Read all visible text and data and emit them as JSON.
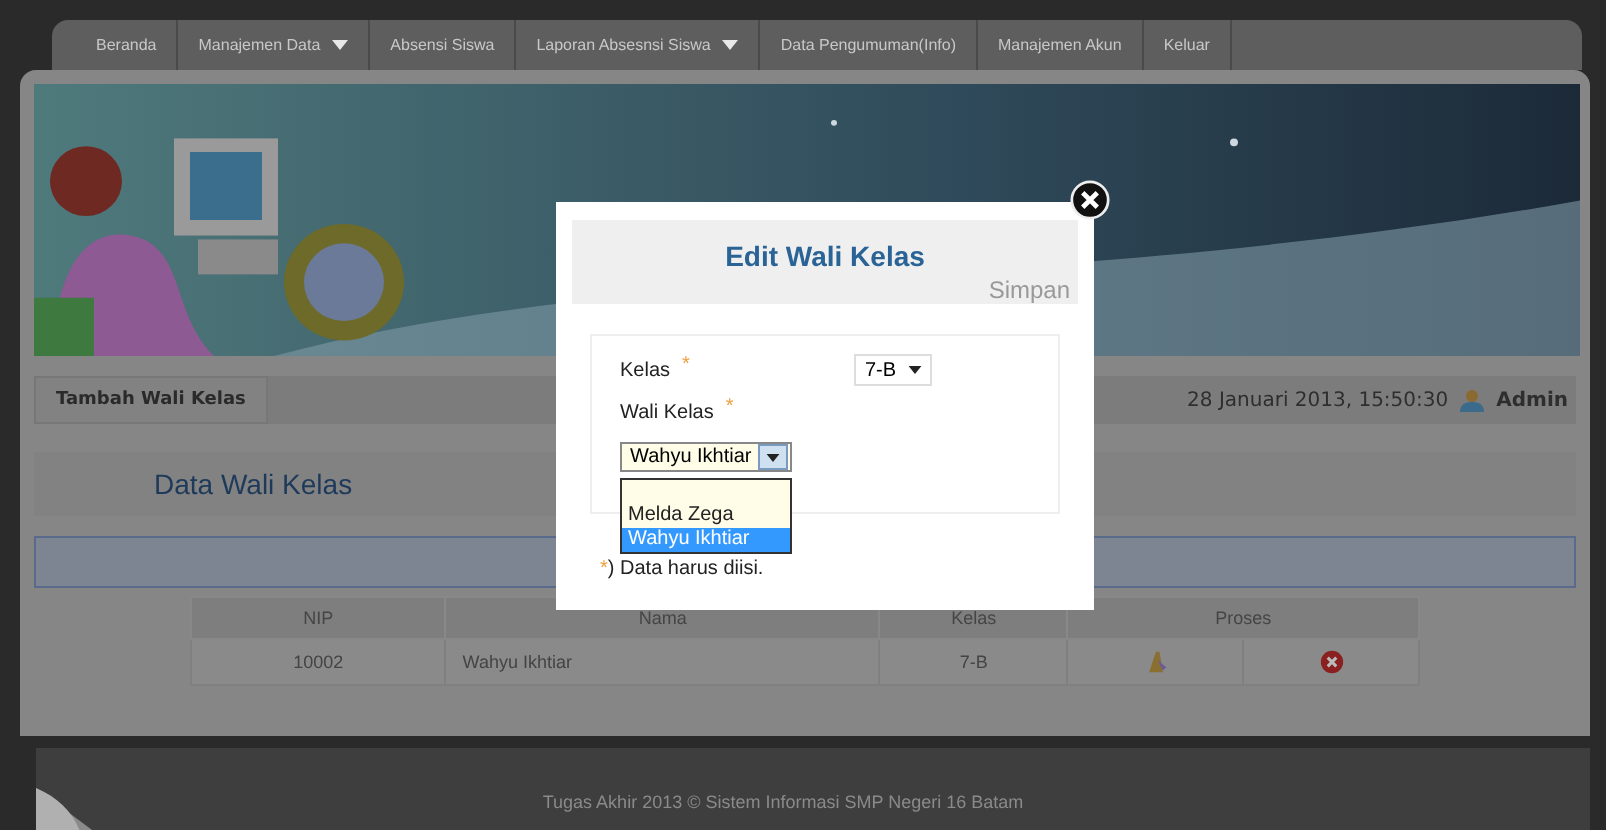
{
  "nav": {
    "items": [
      {
        "label": "Beranda",
        "has_menu": false
      },
      {
        "label": "Manajemen Data",
        "has_menu": true
      },
      {
        "label": "Absensi Siswa",
        "has_menu": false
      },
      {
        "label": "Laporan Absesnsi Siswa",
        "has_menu": true
      },
      {
        "label": "Data Pengumuman(Info)",
        "has_menu": false
      },
      {
        "label": "Manajemen Akun",
        "has_menu": false
      },
      {
        "label": "Keluar",
        "has_menu": false
      }
    ]
  },
  "toolbar": {
    "add_button": "Tambah Wali Kelas",
    "datetime": "28 Januari 2013, 15:50:30",
    "user": "Admin"
  },
  "section_title": "Data Wali Kelas",
  "table": {
    "columns": [
      "NIP",
      "Nama",
      "Kelas",
      "Proses"
    ],
    "rows": [
      {
        "nip": "10002",
        "nama": "Wahyu Ikhtiar",
        "kelas": "7-B"
      }
    ]
  },
  "footer": "Tugas Akhir 2013 © Sistem Informasi SMP Negeri 16 Batam",
  "modal": {
    "title": "Edit Wali Kelas",
    "save": "Simpan",
    "fields": [
      {
        "label": "Kelas",
        "required_mark": "*",
        "value": "7-B"
      },
      {
        "label": "Wali Kelas",
        "required_mark": "*",
        "value": "Wahyu Ikhtiar"
      }
    ],
    "options": [
      {
        "label": "Melda Zega",
        "selected": false
      },
      {
        "label": "Wahyu Ikhtiar",
        "selected": true
      }
    ],
    "note_mark": "*",
    "note": ") Data harus diisi."
  }
}
